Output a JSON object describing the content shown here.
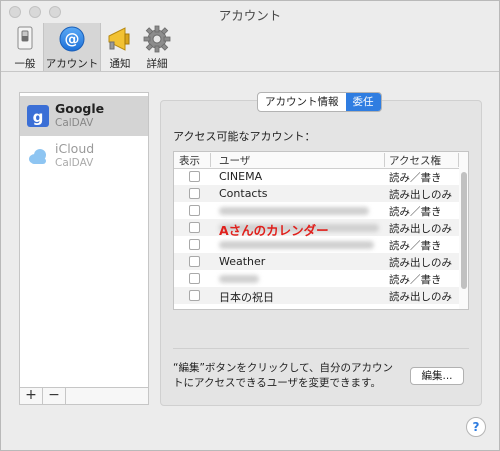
{
  "window": {
    "title": "アカウント"
  },
  "toolbar": {
    "items": [
      {
        "label": "一般",
        "icon": "general-switch-icon"
      },
      {
        "label": "アカウント",
        "icon": "at-sign-icon",
        "selected": true
      },
      {
        "label": "通知",
        "icon": "megaphone-icon"
      },
      {
        "label": "詳細",
        "icon": "gear-icon"
      }
    ]
  },
  "accounts": [
    {
      "name": "Google",
      "type": "CalDAV",
      "icon": "google-icon",
      "selected": true
    },
    {
      "name": "iCloud",
      "type": "CalDAV",
      "icon": "icloud-icon",
      "selected": false
    }
  ],
  "list_controls": {
    "add": "+",
    "remove": "−"
  },
  "tabs": [
    {
      "label": "アカウント情報",
      "active": false
    },
    {
      "label": "委任",
      "active": true
    }
  ],
  "delegation": {
    "label": "アクセス可能なアカウント：",
    "columns": [
      "表示",
      "ユーザ",
      "アクセス権"
    ],
    "rows": [
      {
        "user": "CINEMA",
        "access": "読み／書き"
      },
      {
        "user": "Contacts",
        "access": "読み出しのみ"
      },
      {
        "user": "",
        "access": "読み／書き",
        "blurred": true
      },
      {
        "user": "Aさんのカレンダー",
        "access": "読み出しのみ",
        "highlight": true
      },
      {
        "user": "",
        "access": "読み／書き",
        "blurred": true
      },
      {
        "user": "Weather",
        "access": "読み出しのみ"
      },
      {
        "user": "",
        "access": "読み／書き",
        "blurred": true
      },
      {
        "user": "日本の祝日",
        "access": "読み出しのみ"
      }
    ],
    "help_text": "“編集”ボタンをクリックして、自分のアカウントにアクセスできるユーザを変更できます。",
    "edit_button": "編集..."
  },
  "help_button": "?",
  "colors": {
    "accent": "#2f7de1",
    "highlight_text": "#e0201c"
  }
}
